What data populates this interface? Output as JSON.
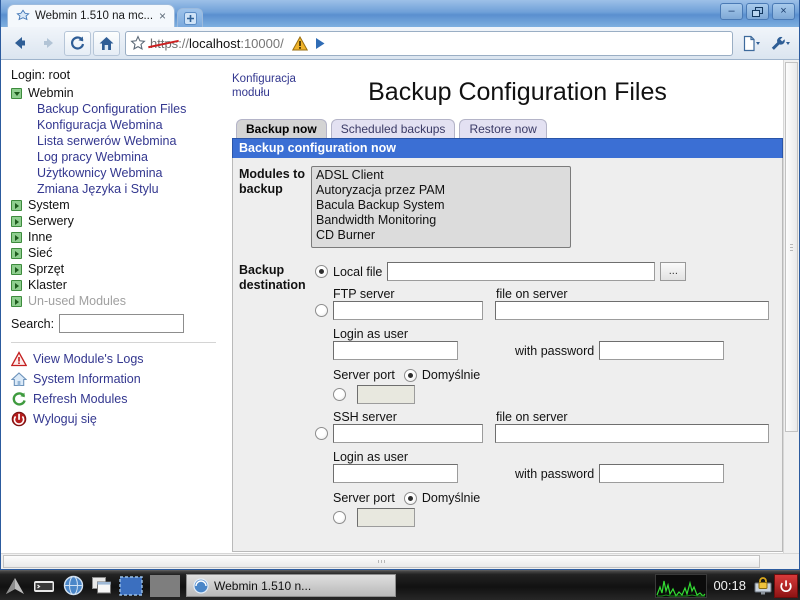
{
  "browser": {
    "tab": {
      "title": "Webmin 1.510 na mc...",
      "favicon_icon": "webmin-favicon",
      "close_icon": "close-icon"
    },
    "newtab_icon": "new-tab-icon",
    "window_controls": {
      "minimize_icon": "minimize-icon",
      "restore_icon": "restore-icon",
      "close_icon": "close-icon",
      "minimize_label": "–",
      "restore_label": "❐",
      "close_label": "×"
    },
    "nav": {
      "back_icon": "back-arrow-icon",
      "forward_icon": "forward-arrow-icon",
      "reload_icon": "reload-icon",
      "home_icon": "home-icon",
      "bookmark_icon": "star-icon",
      "warning_icon": "warning-triangle-icon",
      "go_icon": "go-arrow-icon",
      "page_menu_icon": "page-menu-icon",
      "tools_menu_icon": "wrench-icon"
    },
    "url": {
      "scheme": "https",
      "separator": "://",
      "host": "localhost",
      "port": ":10000",
      "path": "/",
      "full": "https://localhost:10000/",
      "scheme_struck_through": true
    }
  },
  "sidebar": {
    "login_label": "Login: root",
    "categories": [
      {
        "label": "Webmin",
        "state": "open",
        "children": [
          "Backup Configuration Files",
          "Konfiguracja Webmina",
          "Lista serwerów Webmina",
          "Log pracy Webmina",
          "Użytkownicy Webmina",
          "Zmiana Języka i Stylu"
        ]
      },
      {
        "label": "System",
        "state": "closed",
        "children": []
      },
      {
        "label": "Serwery",
        "state": "closed",
        "children": []
      },
      {
        "label": "Inne",
        "state": "closed",
        "children": []
      },
      {
        "label": "Sieć",
        "state": "closed",
        "children": []
      },
      {
        "label": "Sprzęt",
        "state": "closed",
        "children": []
      },
      {
        "label": "Klaster",
        "state": "closed",
        "children": []
      },
      {
        "label": "Un-used Modules",
        "state": "closed",
        "dim": true,
        "children": []
      }
    ],
    "search": {
      "label": "Search:",
      "value": "",
      "placeholder": ""
    },
    "links": [
      {
        "label": "View Module's Logs",
        "icon": "warning-triangle-icon"
      },
      {
        "label": "System Information",
        "icon": "home-icon"
      },
      {
        "label": "Refresh Modules",
        "icon": "refresh-icon"
      },
      {
        "label": "Wyloguj się",
        "icon": "power-icon"
      }
    ]
  },
  "main": {
    "module_config_link": "Konfiguracja modułu",
    "page_title": "Backup Configuration Files",
    "tabs": [
      {
        "label": "Backup now",
        "active": true
      },
      {
        "label": "Scheduled backups",
        "active": false
      },
      {
        "label": "Restore now",
        "active": false
      }
    ],
    "section_header": "Backup configuration now",
    "fields": {
      "modules_label": "Modules to backup",
      "modules_options": [
        "ADSL Client",
        "Autoryzacja przez PAM",
        "Bacula Backup System",
        "Bandwidth Monitoring",
        "CD Burner"
      ],
      "destination_label": "Backup destination",
      "local_file": {
        "radio_label": "Local file",
        "selected": true,
        "value": "",
        "browse_label": "..."
      },
      "ftp": {
        "selected": false,
        "server_label": "FTP server",
        "server_value": "",
        "file_label": "file on server",
        "file_value": "",
        "user_label": "Login as user",
        "user_value": "",
        "password_label": "with password",
        "password_value": "",
        "port_label": "Server port",
        "port_default_label": "Domyślnie",
        "port_default_selected": true,
        "port_value": ""
      },
      "ssh": {
        "selected": false,
        "server_label": "SSH server",
        "server_value": "",
        "file_label": "file on server",
        "file_value": "",
        "user_label": "Login as user",
        "user_value": "",
        "password_label": "with password",
        "password_value": "",
        "port_label": "Server port",
        "port_default_label": "Domyślnie",
        "port_default_selected": true,
        "port_value": ""
      }
    }
  },
  "taskbar": {
    "launchers": [
      {
        "icon": "arch-menu-icon"
      },
      {
        "icon": "terminal-icon"
      },
      {
        "icon": "browser-globe-icon"
      },
      {
        "icon": "windows-overlap-icon"
      },
      {
        "icon": "desktop-preview-icon"
      }
    ],
    "task_button": {
      "label": "Webmin 1.510 n...",
      "icon": "webmin-favicon"
    },
    "tray": {
      "monitor_icon": "system-monitor-graph",
      "clock": "00:18",
      "lock_icon": "lock-screen-icon",
      "power_icon": "power-icon"
    }
  },
  "colors": {
    "accent_blue": "#3b6fd4",
    "tab_active": "#d4d4d4",
    "tab_idle": "#e3e1f2",
    "link": "#33378f",
    "panel": "#eeeeee",
    "power_red": "#c22020"
  }
}
